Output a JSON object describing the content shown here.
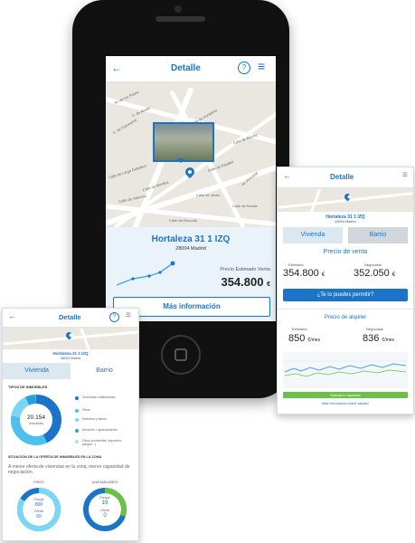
{
  "colors": {
    "accent": "#1b74c8",
    "light_blue": "#4ec0f0",
    "cyan": "#7ad7f4",
    "green": "#6cc04a",
    "tab_bg": "#dbe8ef"
  },
  "icons": {
    "back": "arrow-left-icon",
    "help": "question-circle-icon",
    "menu": "hamburger-menu-icon",
    "pin": "map-pin-icon"
  },
  "phone": {
    "header": {
      "title": "Detalle",
      "back": "←",
      "help": "?",
      "menu": "≡"
    },
    "map_labels": [
      "Av. de los Reyes",
      "C. de Alcalá",
      "C. de Fuencarral",
      "Calle de Larga Caballero",
      "Calle de Mendez",
      "Calle de Hortaleza",
      "Calle de Espalter",
      "Calle de Valencia",
      "Calle de Jesús",
      "Calle de Sevilla",
      "Calle del Escorial",
      "Calle de Atocha",
      "Av. Principal"
    ],
    "address": "Hortaleza 31 1 IZQ",
    "city": "28004 Madrid",
    "price_label": "Precio Estimado Venta",
    "price": "354.800",
    "currency": "€",
    "button": "Más información"
  },
  "card_right": {
    "header": {
      "title": "Detalle",
      "back": "←",
      "menu": "≡"
    },
    "address": "Hortaleza 31 1 IZQ",
    "city": "28004 Madrid",
    "tabs": [
      "Vivienda",
      "Barrio"
    ],
    "sale_title": "Precio de venta",
    "estimated_label": "Estimado",
    "negotiated_label": "Negociado",
    "estimated_value": "354.800",
    "negotiated_value": "352.050",
    "currency": "€",
    "afford_button": "¿Te lo puedes permitir?",
    "rent_title": "Precio de alquiler",
    "rent_estimated": "850",
    "rent_negotiated": "836",
    "rent_unit": "€/mes",
    "green_button": "Solicita tu hipoteca",
    "footer_link": "Más información sobre alquiler"
  },
  "card_left": {
    "header": {
      "title": "Detalle",
      "back": "←",
      "help": "?",
      "menu": "≡"
    },
    "address": "Hortaleza 31 1 IZQ",
    "city": "28004 Madrid",
    "tabs": [
      "Vivienda",
      "Barrio"
    ],
    "types_title": "TIPOS DE INMUEBLES",
    "donut_value": "20.154",
    "donut_label": "Inmuebles",
    "legend": [
      "Viviendas unifamiliares",
      "Pisos",
      "Estudios y áticos",
      "Almacén / aparcamiento",
      "Otros (comercial, deportivo, parque...)"
    ],
    "offer_title": "SITUACIÓN DE LA OFERTA DE INMUEBLES EN LA ZONA",
    "offer_text": "A menor oferta de viviendas en la zona, menor capacidad de negociación.",
    "pisos_title": "PISOS",
    "unif_title": "UNIFAMILIARES",
    "parque_label": "Parque",
    "oferta_label": "Oferta",
    "pisos_parque": "800",
    "pisos_oferta": "60",
    "unif_parque": "19",
    "unif_oferta": "0"
  }
}
